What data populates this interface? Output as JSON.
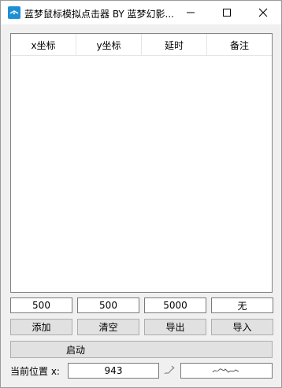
{
  "window": {
    "title": "蓝梦鼠标模拟点击器 BY 蓝梦幻影..."
  },
  "list": {
    "columns": [
      "x坐标",
      "y坐标",
      "延时",
      "备注"
    ]
  },
  "inputs": {
    "x": "500",
    "y": "500",
    "delay": "5000",
    "note": "无"
  },
  "buttons": {
    "add": "添加",
    "clear": "清空",
    "export": "导出",
    "import": "导入",
    "start": "启动"
  },
  "status": {
    "label": "当前位置 x:",
    "x_value": "943",
    "signature_text": "蓝梦"
  },
  "colors": {
    "icon_blue": "#1e8fd6",
    "window_bg": "#f0f0f0",
    "button_bg": "#e1e1e1"
  }
}
